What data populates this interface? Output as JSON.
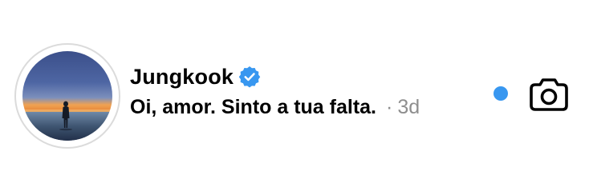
{
  "thread": {
    "username": "Jungkook",
    "verified": true,
    "message": "Oi, amor. Sinto a tua falta.",
    "separator": "·",
    "time": "3d",
    "unread": true
  },
  "icons": {
    "avatar": "profile-photo-sunset-silhouette",
    "verified": "verified-badge-icon",
    "camera": "camera-icon"
  },
  "colors": {
    "verified": "#3897f0",
    "unread_dot": "#3897f0",
    "secondary_text": "#8e8e8e",
    "avatar_ring": "#dbdbdb"
  }
}
